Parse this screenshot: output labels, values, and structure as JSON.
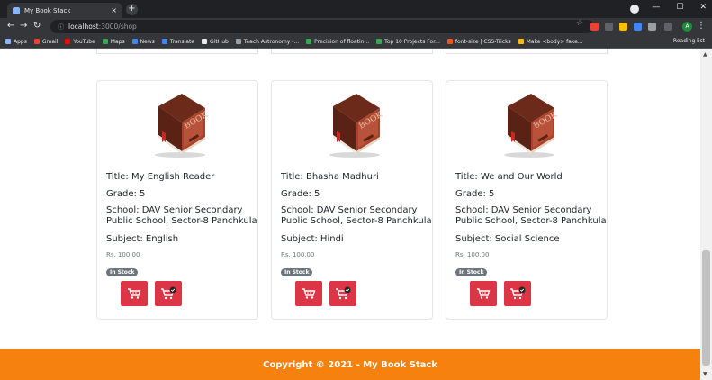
{
  "browser": {
    "tab_title": "My Book Stack",
    "tab_close": "×",
    "new_tab": "+",
    "url_host": "localhost",
    "url_path": ":3000/shop",
    "bookmarks": [
      {
        "label": "Apps",
        "color": "#8ab4f8"
      },
      {
        "label": "Gmail",
        "color": "#ea4335"
      },
      {
        "label": "YouTube",
        "color": "#ff0000"
      },
      {
        "label": "Maps",
        "color": "#34a853"
      },
      {
        "label": "News",
        "color": "#4285f4"
      },
      {
        "label": "Translate",
        "color": "#4285f4"
      },
      {
        "label": "GitHub",
        "color": "#e8eaed"
      },
      {
        "label": "Teach Astronomy -...",
        "color": "#9aa0a6"
      },
      {
        "label": "Precision of floatin...",
        "color": "#34a853"
      },
      {
        "label": "Top 10 Projects For...",
        "color": "#34a853"
      },
      {
        "label": "font-size | CSS-Tricks",
        "color": "#f4511e"
      },
      {
        "label": "Make <body> fake...",
        "color": "#fbbc04"
      }
    ],
    "reading_list": "Reading list",
    "avatar_letter": "A"
  },
  "books": [
    {
      "title": "Title: My English Reader",
      "grade": "Grade: 5",
      "school": "School: DAV Senior Secondary Public School, Sector-8 Panchkula",
      "subject": "Subject: English",
      "price": "Rs. 100.00",
      "stock": "In Stock"
    },
    {
      "title": "Title: Bhasha Madhuri",
      "grade": "Grade: 5",
      "school": "School: DAV Senior Secondary Public School, Sector-8 Panchkula",
      "subject": "Subject: Hindi",
      "price": "Rs. 100.00",
      "stock": "In Stock"
    },
    {
      "title": "Title: We and Our World",
      "grade": "Grade: 5",
      "school": "School: DAV Senior Secondary Public School, Sector-8 Panchkula",
      "subject": "Subject: Social Science",
      "price": "Rs. 100.00",
      "stock": "In Stock"
    }
  ],
  "footer": {
    "text": "Copyright © 2021 - My Book Stack",
    "color": "#f7810f"
  },
  "colors": {
    "button": "#dc3545",
    "badge": "#6c757d"
  }
}
